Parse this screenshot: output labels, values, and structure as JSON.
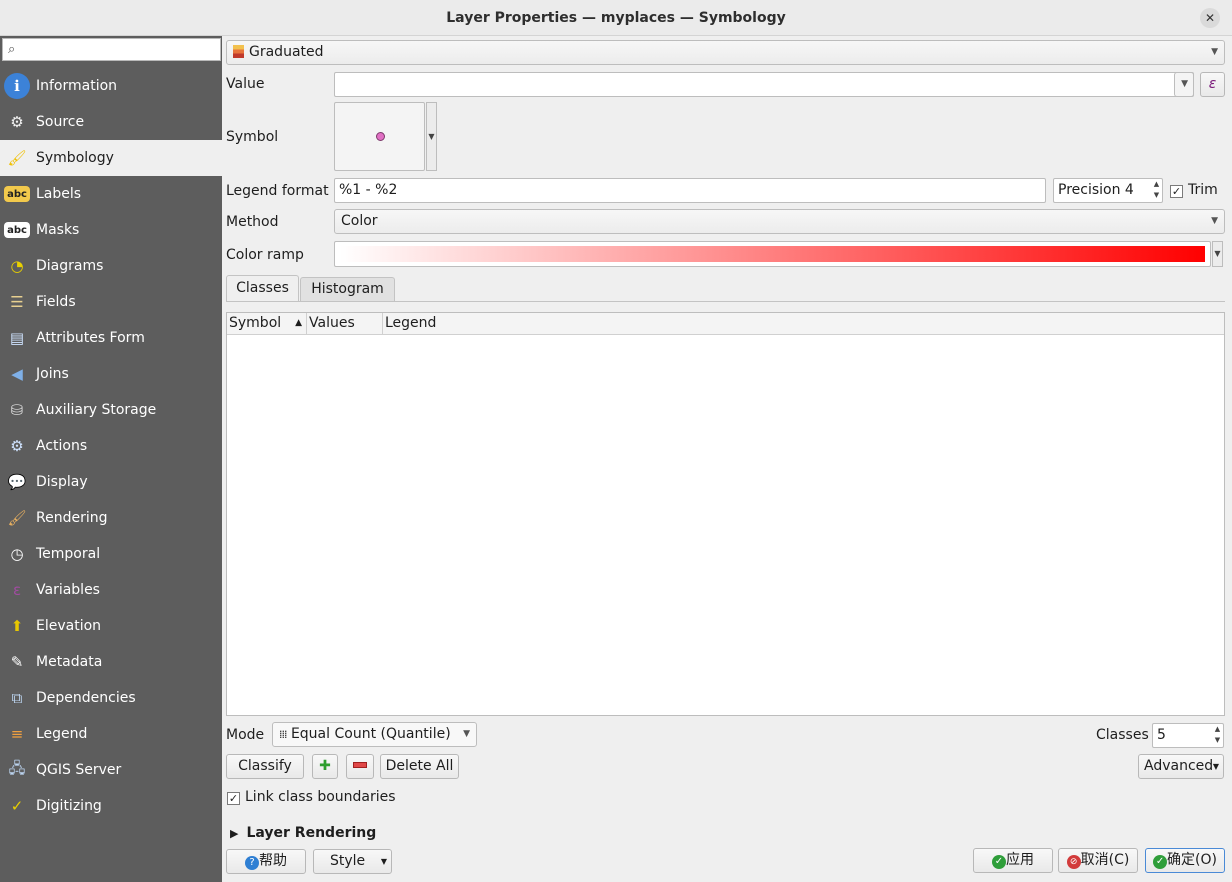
{
  "window": {
    "title": "Layer Properties — myplaces — Symbology"
  },
  "sidebar": {
    "search_placeholder": "",
    "items": [
      {
        "label": "Information",
        "icon": "information-icon"
      },
      {
        "label": "Source",
        "icon": "source-icon"
      },
      {
        "label": "Symbology",
        "icon": "symbology-icon"
      },
      {
        "label": "Labels",
        "icon": "labels-icon"
      },
      {
        "label": "Masks",
        "icon": "masks-icon"
      },
      {
        "label": "Diagrams",
        "icon": "diagrams-icon"
      },
      {
        "label": "Fields",
        "icon": "fields-icon"
      },
      {
        "label": "Attributes Form",
        "icon": "attributes-form-icon"
      },
      {
        "label": "Joins",
        "icon": "joins-icon"
      },
      {
        "label": "Auxiliary Storage",
        "icon": "auxiliary-storage-icon"
      },
      {
        "label": "Actions",
        "icon": "actions-icon"
      },
      {
        "label": "Display",
        "icon": "display-icon"
      },
      {
        "label": "Rendering",
        "icon": "rendering-icon"
      },
      {
        "label": "Temporal",
        "icon": "temporal-icon"
      },
      {
        "label": "Variables",
        "icon": "variables-icon"
      },
      {
        "label": "Elevation",
        "icon": "elevation-icon"
      },
      {
        "label": "Metadata",
        "icon": "metadata-icon"
      },
      {
        "label": "Dependencies",
        "icon": "dependencies-icon"
      },
      {
        "label": "Legend",
        "icon": "legend-icon"
      },
      {
        "label": "QGIS Server",
        "icon": "qgis-server-icon"
      },
      {
        "label": "Digitizing",
        "icon": "digitizing-icon"
      }
    ],
    "active_index": 2
  },
  "renderer": {
    "type": "Graduated"
  },
  "value": {
    "label": "Value",
    "current": ""
  },
  "symbol": {
    "label": "Symbol",
    "color": "#e06fc3"
  },
  "legend_format": {
    "label": "Legend format",
    "value": "%1 - %2",
    "precision": "Precision 4",
    "trim_label": "Trim",
    "trim_checked": true
  },
  "method": {
    "label": "Method",
    "value": "Color"
  },
  "color_ramp": {
    "label": "Color ramp",
    "start": "#ffffff",
    "end": "#ff0000"
  },
  "tabs": [
    {
      "label": "Classes"
    },
    {
      "label": "Histogram"
    }
  ],
  "table": {
    "columns": [
      "Symbol",
      "Values",
      "Legend"
    ],
    "rows": []
  },
  "mode": {
    "label": "Mode",
    "value": "Equal Count (Quantile)"
  },
  "classes": {
    "label": "Classes",
    "value": "5"
  },
  "actions": {
    "classify": "Classify",
    "delete_all": "Delete All",
    "advanced": "Advanced"
  },
  "link_boundaries": {
    "label": "Link class boundaries",
    "checked": true
  },
  "layer_rendering": {
    "label": "Layer Rendering"
  },
  "footer": {
    "help": "帮助",
    "style": "Style",
    "apply": "应用",
    "cancel": "取消(C)",
    "ok": "确定(O)"
  }
}
